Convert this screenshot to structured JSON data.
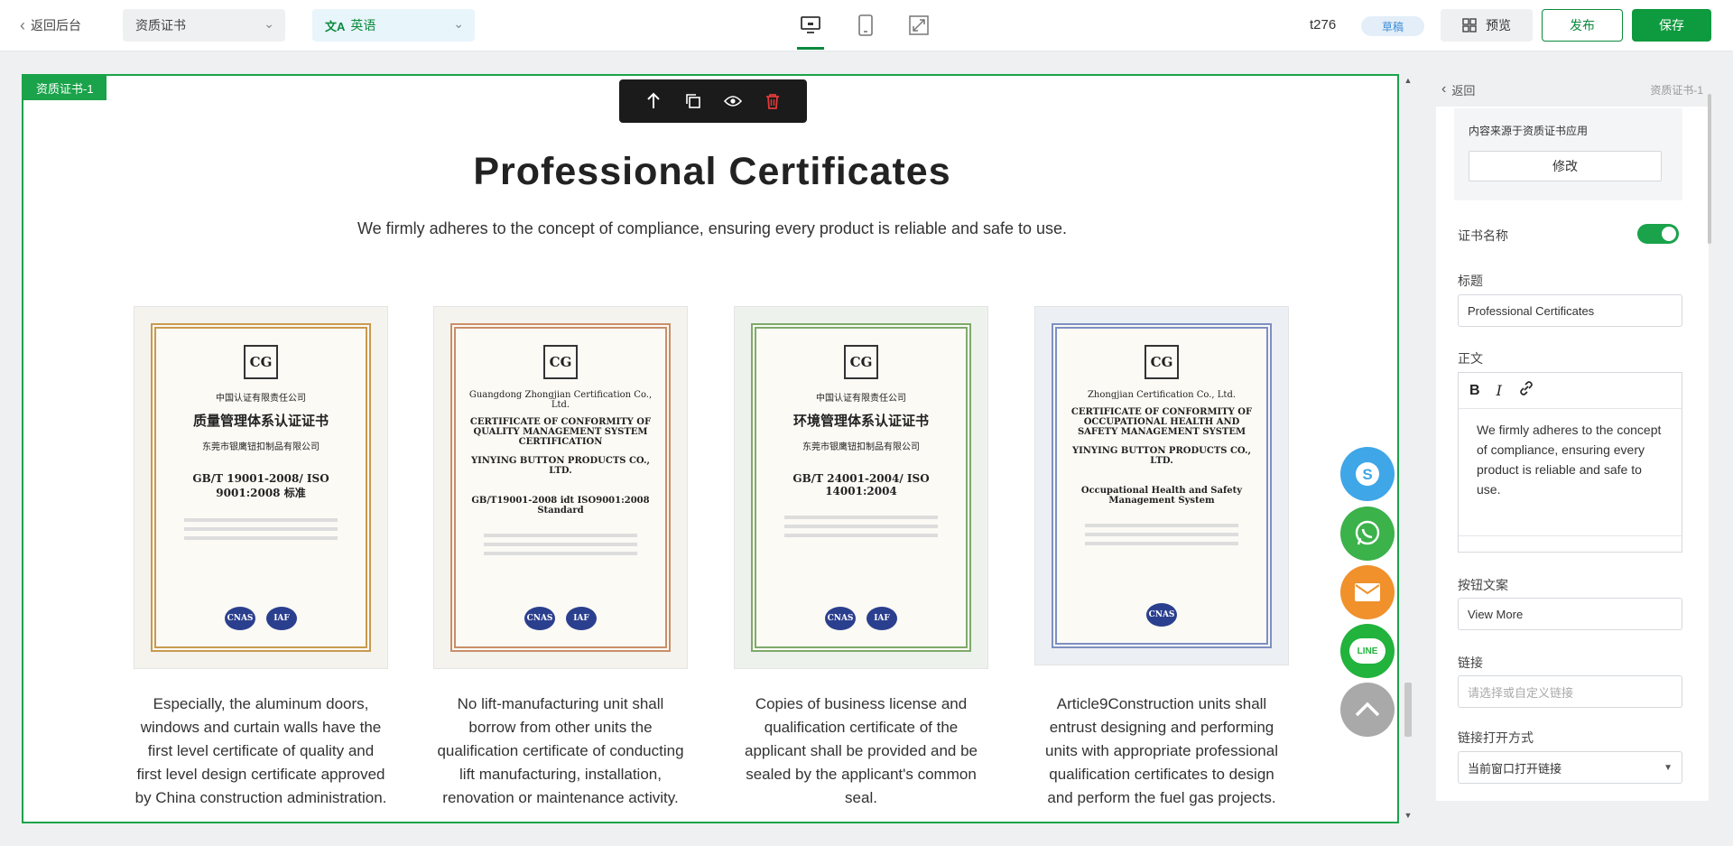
{
  "topbar": {
    "back_label": "返回后台",
    "page_select": "资质证书",
    "language_select": "英语",
    "site_name": "t276",
    "status_badge": "草稿",
    "preview_label": "预览",
    "publish_label": "发布",
    "save_label": "保存"
  },
  "canvas": {
    "section_tag": "资质证书-1",
    "heading": "Professional Certificates",
    "subtitle": "We firmly adheres to the concept of compliance, ensuring every product is reliable and safe to use.",
    "certificates": [
      {
        "top": "中国认证有限责任公司",
        "title": "质量管理体系认证证书",
        "sub": "东莞市银鹰钮扣制品有限公司",
        "std": "GB/T 19001-2008/ ISO 9001:2008 标准",
        "desc": "Especially, the aluminum doors, windows and curtain walls have the first level certificate of quality and first level design certificate approved by China construction administration."
      },
      {
        "top": "Guangdong Zhongjian Certification Co., Ltd.",
        "title": "CERTIFICATE OF CONFORMITY OF QUALITY MANAGEMENT SYSTEM CERTIFICATION",
        "sub": "YINYING BUTTON PRODUCTS CO., LTD.",
        "std": "GB/T19001-2008 idt ISO9001:2008 Standard",
        "desc": "No lift-manufacturing unit shall borrow from other units the qualification certificate of conducting lift manufacturing, installation, renovation or maintenance activity."
      },
      {
        "top": "中国认证有限责任公司",
        "title": "环境管理体系认证证书",
        "sub": "东莞市银鹰钮扣制品有限公司",
        "std": "GB/T 24001-2004/ ISO 14001:2004",
        "desc": "Copies of business license and qualification certificate of the applicant shall be provided and be sealed by the applicant's common seal."
      },
      {
        "top": "Zhongjian Certification Co., Ltd.",
        "title": "CERTIFICATE OF CONFORMITY OF OCCUPATIONAL HEALTH AND SAFETY MANAGEMENT SYSTEM",
        "sub": "YINYING BUTTON PRODUCTS CO., LTD.",
        "std": "Occupational Health and Safety Management System",
        "desc": "Article9Construction units shall entrust designing and performing units with appropriate professional qualification certificates to design and perform the fuel gas projects."
      }
    ],
    "seal_text": "IAF",
    "logo_text": "CG"
  },
  "floating": {
    "skype_icon": "S",
    "line_label": "LINE"
  },
  "panel": {
    "back_label": "返回",
    "panel_title": "资质证书-1",
    "source_text": "内容来源于资质证书应用",
    "edit_label": "修改",
    "cert_name_label": "证书名称",
    "title_label": "标题",
    "title_value": "Professional Certificates",
    "body_label": "正文",
    "body_text": "We firmly adheres to the concept of compliance, ensuring every product is reliable and safe to use.",
    "button_text_label": "按钮文案",
    "button_text_value": "View More",
    "link_label": "链接",
    "link_placeholder": "请选择或自定义链接",
    "link_open_label": "链接打开方式",
    "link_open_value": "当前窗口打开链接"
  },
  "colors": {
    "accent": "#1aa34a",
    "skype": "#3fa6e8",
    "whatsapp": "#3bb24a",
    "email": "#f0912c",
    "line": "#21b33c",
    "top": "#a9a9a9"
  }
}
